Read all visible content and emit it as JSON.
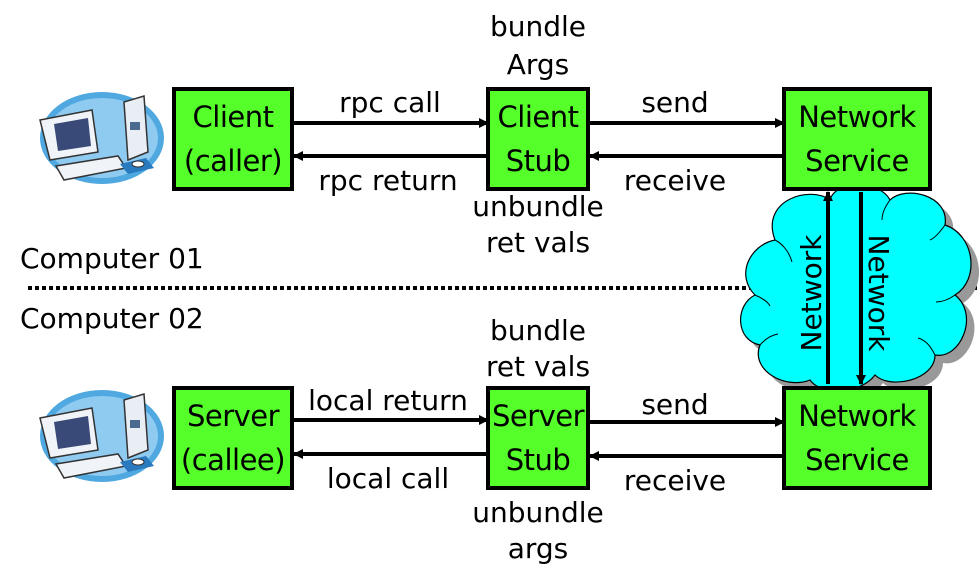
{
  "diagram": {
    "colors": {
      "box_fill": "#55ff2a",
      "cloud_fill": "#00ffff",
      "cloud_shadow": "#999999",
      "line": "#000000",
      "pc_circle": "#4fa8e0"
    },
    "computer1": {
      "label": "Computer 01",
      "client": {
        "line1": "Client",
        "line2": "(caller)"
      },
      "client_stub": {
        "line1": "Client",
        "line2": "Stub"
      },
      "network_service": {
        "line1": "Network",
        "line2": "Service"
      },
      "above_stub": [
        "bundle",
        "Args"
      ],
      "below_stub": [
        "unbundle",
        "ret vals"
      ],
      "arrow_call": "rpc call",
      "arrow_return": "rpc return",
      "arrow_send": "send",
      "arrow_receive": "receive"
    },
    "computer2": {
      "label": "Computer 02",
      "server": {
        "line1": "Server",
        "line2": "(callee)"
      },
      "server_stub": {
        "line1": "Server",
        "line2": "Stub"
      },
      "network_service": {
        "line1": "Network",
        "line2": "Service"
      },
      "above_stub": [
        "bundle",
        "ret vals"
      ],
      "below_stub": [
        "unbundle",
        "args"
      ],
      "arrow_return": "local return",
      "arrow_call": "local call",
      "arrow_send": "send",
      "arrow_receive": "receive"
    },
    "network": {
      "up_label": "Network",
      "down_label": "Network"
    },
    "icons": [
      "desktop-computer-icon",
      "desktop-computer-icon",
      "network-cloud-icon"
    ]
  }
}
